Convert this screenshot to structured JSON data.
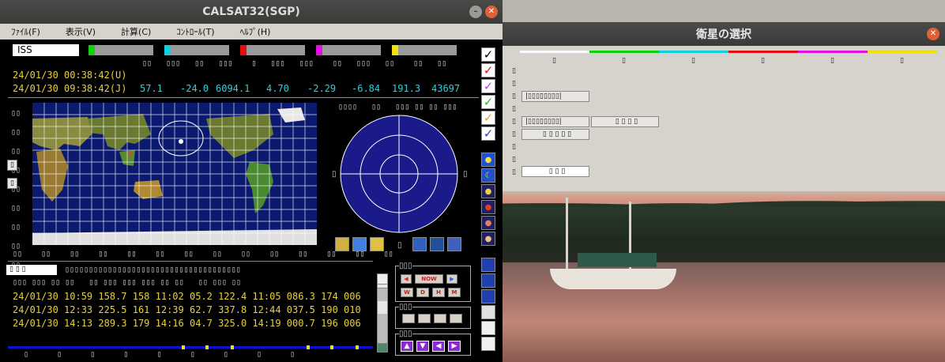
{
  "main_window": {
    "title": "CALSAT32(SGP)",
    "menu": [
      "ﾌｧｲﾙ(F)",
      "表示(V)",
      "計算(C)",
      "ｺﾝﾄﾛｰﾙ(T)",
      "ﾍﾙﾌﾟ(H)"
    ]
  },
  "satellite": {
    "name": "ISS",
    "slot_colors": [
      "#10d010",
      "#10d0e0",
      "#e01010",
      "#e010e0",
      "#f0e010"
    ],
    "time_utc": "24/01/30 00:38:42(U)",
    "time_jst": "24/01/30 09:38:42(J)",
    "values": [
      "57.1",
      "-24.0",
      "6094.1",
      "4.70",
      "-2.29",
      "-6.84",
      "191.3",
      "43697"
    ]
  },
  "passes": [
    "24/01/30 10:59 158.7 158  11:02 05.2 122.4  11:05 086.3 174  006",
    "24/01/30 12:33 225.5 161  12:39 62.7 337.8  12:44 037.5 190  010",
    "24/01/30 14:13 289.3 179  14:16 04.7 325.0  14:19 000.7 196  006"
  ],
  "controls": {
    "now_label": "NOW",
    "sub_labels": [
      "W",
      "D",
      "H",
      "M"
    ]
  },
  "check_colors": [
    "#000000",
    "#e01010",
    "#c040e0",
    "#20c020",
    "#f0a020",
    "#2040e0"
  ],
  "dialog": {
    "title": "衛星の選択",
    "line_colors": [
      "#ffffff",
      "#10d010",
      "#10d0e0",
      "#e01010",
      "#e010e0",
      "#f0e010"
    ]
  }
}
